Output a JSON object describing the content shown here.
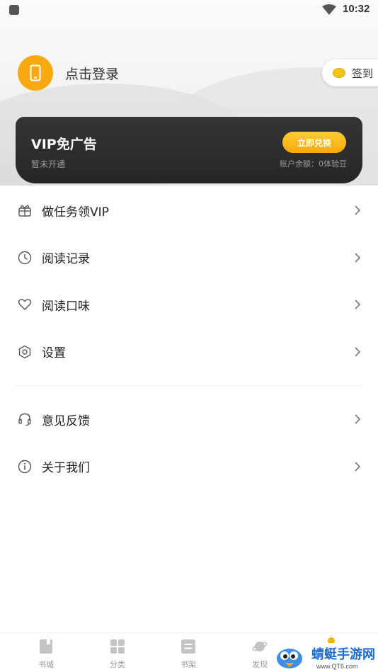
{
  "status_bar": {
    "time": "10:32"
  },
  "profile": {
    "login_text": "点击登录",
    "signin_label": "签到"
  },
  "vip": {
    "title": "VIP免广告",
    "status": "暂未开通",
    "redeem_button": "立即兑换",
    "balance": "账户余额：0体验豆"
  },
  "menu": {
    "items": [
      {
        "label": "做任务领VIP",
        "icon": "gift-icon"
      },
      {
        "label": "阅读记录",
        "icon": "clock-icon"
      },
      {
        "label": "阅读口味",
        "icon": "heart-icon"
      },
      {
        "label": "设置",
        "icon": "hexagon-settings-icon"
      },
      {
        "label": "意见反馈",
        "icon": "headset-icon"
      },
      {
        "label": "关于我们",
        "icon": "info-icon"
      }
    ]
  },
  "tabbar": {
    "tabs": [
      {
        "label": "书城",
        "icon": "book-icon"
      },
      {
        "label": "分类",
        "icon": "grid-icon"
      },
      {
        "label": "书架",
        "icon": "shelf-icon"
      },
      {
        "label": "发现",
        "icon": "planet-icon"
      }
    ]
  },
  "watermark": {
    "title": "蜻蜓手游网",
    "url": "www.QT6.com"
  },
  "colors": {
    "accent": "#f8a912",
    "vip_card": "#2c2c2c",
    "text": "#222222"
  }
}
